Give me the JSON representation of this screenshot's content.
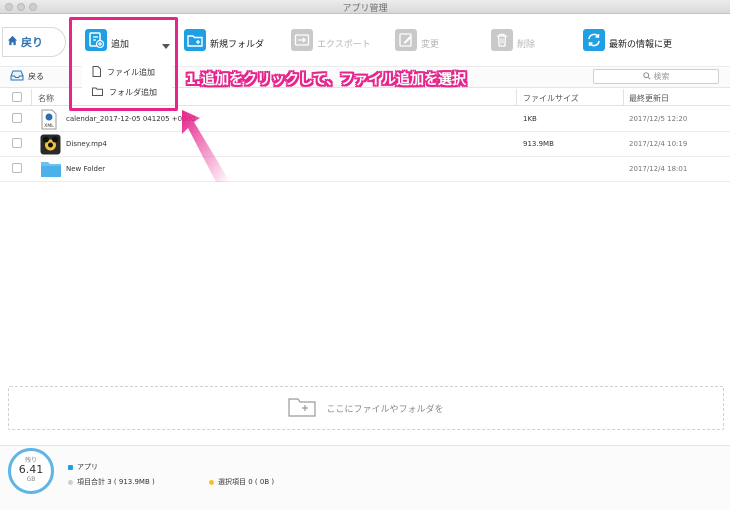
{
  "window": {
    "title": "アプリ管理"
  },
  "toolbar": {
    "back_label": "戻り",
    "add_label": "追加",
    "new_folder_label": "新規フォルダ",
    "export_label": "エクスポート",
    "edit_label": "変更",
    "delete_label": "削除",
    "refresh_label": "最新の情報に更"
  },
  "add_menu": {
    "items": [
      {
        "label": "ファイル追加"
      },
      {
        "label": "フォルダ追加"
      }
    ]
  },
  "annotation": {
    "text": "1.追加をクリックして、ファイル追加を選択"
  },
  "subbar": {
    "back_label": "戻る",
    "search_placeholder": "検索"
  },
  "table": {
    "headers": {
      "name": "名称",
      "size": "ファイルサイズ",
      "modified": "最終更新日"
    },
    "rows": [
      {
        "name": "calendar_2017-12-05 041205 +0000",
        "size": "1KB",
        "modified": "2017/12/5  12:20",
        "icon": "xml-file-icon"
      },
      {
        "name": "Disney.mp4",
        "size": "913.9MB",
        "modified": "2017/12/4  10:19",
        "icon": "video-file-icon"
      },
      {
        "name": "New Folder",
        "size": "",
        "modified": "2017/12/4  18:01",
        "icon": "folder-icon"
      }
    ]
  },
  "dropzone": {
    "text": "ここにファイルやフォルダを"
  },
  "footer": {
    "remaining_label": "残り",
    "remaining_value": "6.41",
    "remaining_unit": "GB",
    "category": "アプリ",
    "total_items": "項目合計 3 ( 913.9MB )",
    "selected_items": "選択項目 0 ( 0B )"
  },
  "colors": {
    "accent": "#1fa0e4",
    "highlight": "#e6248c",
    "category_dot": "#1fa0e4",
    "selected_dot": "#f3c12e"
  }
}
